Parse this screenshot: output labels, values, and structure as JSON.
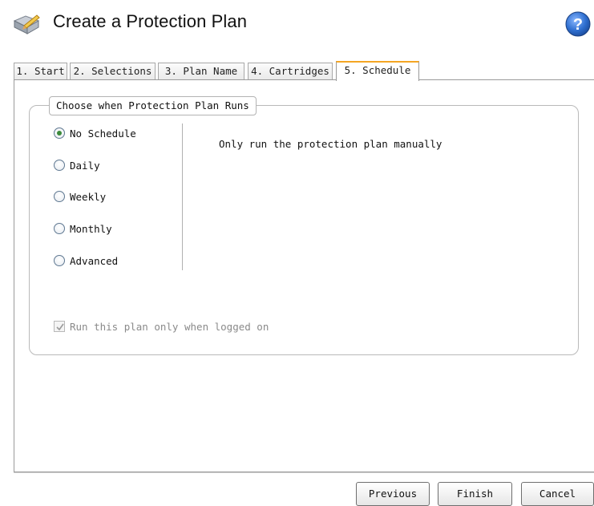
{
  "window": {
    "title": "Create a Protection Plan"
  },
  "icons": {
    "app": "protection-plan-icon",
    "help": "help-icon"
  },
  "tabs": [
    {
      "label": "1. Start"
    },
    {
      "label": "2. Selections"
    },
    {
      "label": "3. Plan Name"
    },
    {
      "label": "4. Cartridges"
    },
    {
      "label": "5. Schedule",
      "active": true
    }
  ],
  "schedule": {
    "group_title": "Choose when Protection Plan Runs",
    "options": [
      {
        "label": "No Schedule",
        "selected": true
      },
      {
        "label": "Daily"
      },
      {
        "label": "Weekly"
      },
      {
        "label": "Monthly"
      },
      {
        "label": "Advanced"
      }
    ],
    "description": "Only run the protection plan manually",
    "logged_on_only": {
      "label": "Run this plan only when logged on",
      "checked": true,
      "disabled": true
    }
  },
  "buttons": {
    "previous": "Previous",
    "finish": "Finish",
    "cancel": "Cancel"
  },
  "colors": {
    "active_tab_accent": "#f5a623",
    "help_blue": "#2f6fd0",
    "radio_selected": "#3b8a3b"
  }
}
